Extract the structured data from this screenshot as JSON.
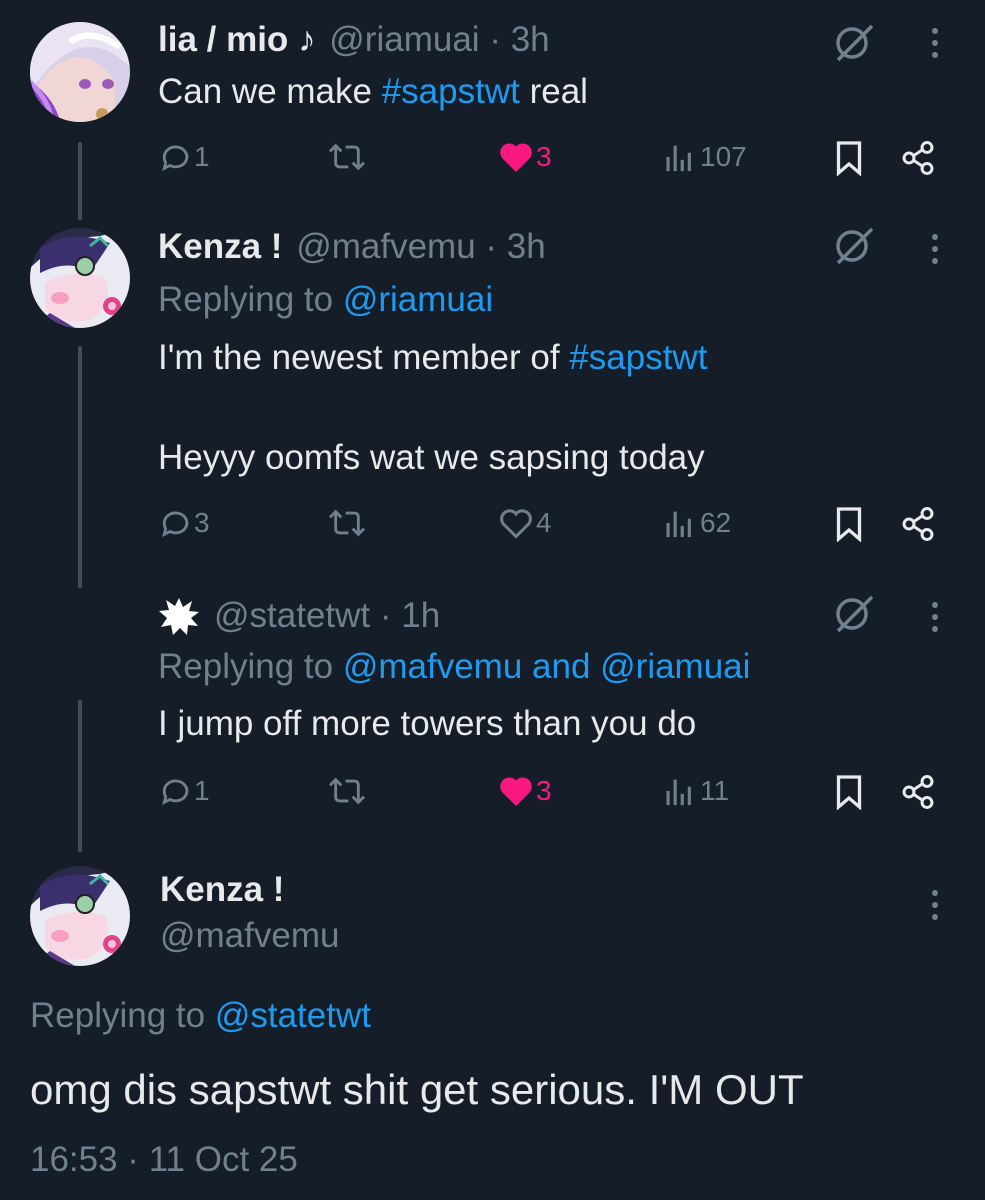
{
  "colors": {
    "background": "#151d28",
    "text": "#e7e9ea",
    "muted": "#71808e",
    "link": "#1d9bf0",
    "like": "#f91880"
  },
  "tweets": [
    {
      "name": "lia / mio ♪",
      "handle": "@riamuai",
      "time": "· 3h",
      "text_before": "Can we make ",
      "hashtag": "#sapstwt",
      "text_after": " real",
      "replies": "1",
      "likes": "3",
      "views": "107",
      "liked": true
    },
    {
      "name": "Kenza !",
      "handle": "@mafvemu",
      "time": "· 3h",
      "replying_prefix": "Replying to ",
      "replying_to": "@riamuai",
      "line1_before": "I'm the newest member of ",
      "line1_hashtag": "#sapstwt",
      "line2": "Heyyy oomfs wat we sapsing today",
      "replies": "3",
      "likes": "4",
      "views": "62",
      "liked": false
    },
    {
      "handle": "@statetwt",
      "time": "· 1h",
      "replying_prefix": "Replying to ",
      "replying_to": "@mafvemu and @riamuai",
      "text": "I jump off more towers than you do",
      "replies": "1",
      "likes": "3",
      "views": "11",
      "liked": true
    }
  ],
  "main_tweet": {
    "name": "Kenza !",
    "handle": "@mafvemu",
    "replying_prefix": "Replying to ",
    "replying_to": "@statetwt",
    "text": "omg dis sapstwt shit get serious. I'M OUT",
    "timestamp": "16:53 · 11 Oct 25"
  },
  "icons": [
    "reply-icon",
    "retweet-icon",
    "like-icon",
    "views-icon",
    "bookmark-icon",
    "share-icon",
    "grok-icon",
    "more-icon"
  ]
}
